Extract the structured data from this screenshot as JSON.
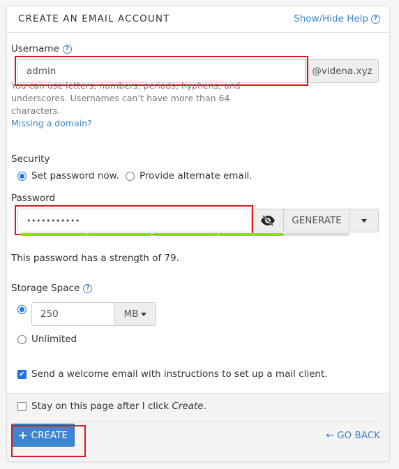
{
  "header": {
    "title": "CREATE AN EMAIL ACCOUNT",
    "help_link": "Show/Hide Help",
    "help_icon": "question-circle-icon"
  },
  "username": {
    "label": "Username",
    "value": "admin",
    "domain": "@videna.xyz",
    "help_text": "You can use letters, numbers, periods, hyphens, and underscores. Usernames can’t have more than 64 characters.",
    "missing_domain_link": "Missing a domain?"
  },
  "security": {
    "label": "Security",
    "options": [
      {
        "label": "Set password now.",
        "checked": true
      },
      {
        "label": "Provide alternate email.",
        "checked": false
      }
    ]
  },
  "password": {
    "label": "Password",
    "value": "•••••••••••",
    "toggle_icon": "eye-slash-icon",
    "generate_label": "GENERATE",
    "dropdown_icon": "caret-down-icon",
    "strength": 79,
    "strength_segments_filled": 4,
    "strength_segments_total": 5,
    "strength_text": "This password has a strength of 79.",
    "strength_color": "#8ee000",
    "strength_empty_color": "#dddddd"
  },
  "storage": {
    "label": "Storage Space",
    "quota_value": "250",
    "unit": "MB",
    "quota_checked": true,
    "unlimited_label": "Unlimited",
    "unlimited_checked": false
  },
  "welcome_email": {
    "label": "Send a welcome email with instructions to set up a mail client.",
    "checked": true
  },
  "footer": {
    "stay_label_prefix": "Stay on this page after I click ",
    "stay_label_em": "Create",
    "stay_label_suffix": ".",
    "stay_checked": false,
    "create_label": "CREATE",
    "create_color": "#3b86cf",
    "go_back_label": "GO BACK"
  }
}
